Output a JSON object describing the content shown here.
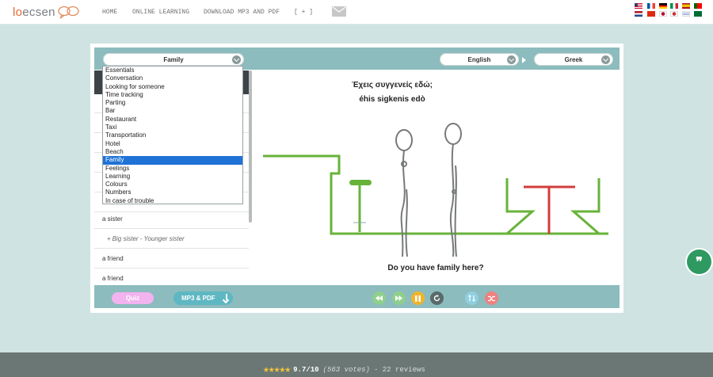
{
  "header": {
    "logo_text_a": "lo",
    "logo_text_b": "ecsen",
    "nav": [
      "HOME",
      "ONLINE LEARNING",
      "DOWNLOAD MP3 AND PDF",
      "[ + ]"
    ],
    "mail_icon": "mail-icon",
    "flag_icons": [
      "us",
      "fr",
      "de",
      "it",
      "es",
      "pt",
      "nl",
      "cn",
      "jp",
      "kr",
      "il",
      "sa"
    ]
  },
  "toolbar": {
    "category_selected": "Family",
    "source_language": "English",
    "target_language": "Greek"
  },
  "category_dropdown": {
    "options": [
      "Essentials",
      "Conversation",
      "Looking for someone",
      "Time tracking",
      "Parting",
      "Bar",
      "Restaurant",
      "Taxi",
      "Transportation",
      "Hotel",
      "Beach",
      "Family",
      "Feelings",
      "Learning",
      "Colours",
      "Numbers",
      "In case of trouble"
    ],
    "selected_index": 11
  },
  "phrase_list": [
    {
      "text": "a sister",
      "sub": false
    },
    {
      "text": "Big sister - Younger sister",
      "sub": true
    },
    {
      "text": "a friend",
      "sub": false
    },
    {
      "text": "a friend",
      "sub": false
    }
  ],
  "scene": {
    "phrase_target": "Έχεις συγγενείς εδώ;",
    "phrase_romanized": "éhis sigkenis edò",
    "phrase_source": "Do you have family here?"
  },
  "footer_controls": {
    "quiz_label": "Quiz",
    "mp3_label": "MP3 & PDF",
    "buttons": [
      "rewind-icon",
      "forward-icon",
      "pause-icon",
      "repeat-icon",
      "swap-icon",
      "shuffle-icon"
    ],
    "pause_color": "#f0b429",
    "green_color": "#8fcf8d",
    "blue_color": "#8fcfe0",
    "red_color": "#f08080"
  },
  "rating": {
    "stars": "★★★★★",
    "score": "9.7/10",
    "votes": "(563 votes)",
    "reviews": "- 22 reviews"
  },
  "chat_icon": "quote-icon"
}
